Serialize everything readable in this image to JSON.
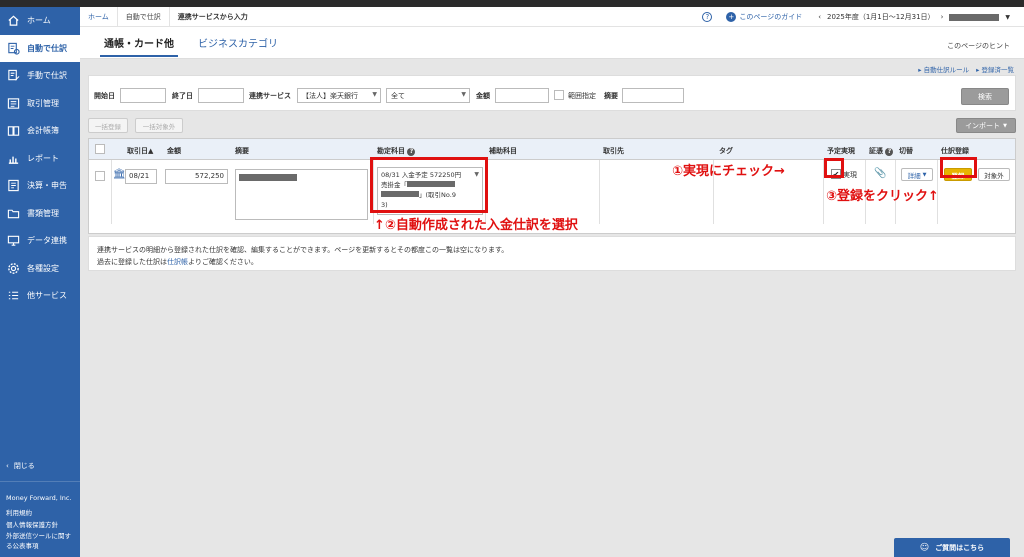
{
  "sidebar": {
    "items": [
      {
        "label": "ホーム",
        "icon": "home-icon"
      },
      {
        "label": "自動で仕訳",
        "icon": "auto-journal-icon"
      },
      {
        "label": "手動で仕訳",
        "icon": "manual-journal-icon"
      },
      {
        "label": "取引管理",
        "icon": "transaction-icon"
      },
      {
        "label": "会計帳簿",
        "icon": "ledger-icon"
      },
      {
        "label": "レポート",
        "icon": "report-icon"
      },
      {
        "label": "決算・申告",
        "icon": "settlement-icon"
      },
      {
        "label": "書類管理",
        "icon": "folder-icon"
      },
      {
        "label": "データ連携",
        "icon": "data-link-icon"
      },
      {
        "label": "各種設定",
        "icon": "gear-icon"
      },
      {
        "label": "他サービス",
        "icon": "list-icon"
      }
    ],
    "close_label": "閉じる",
    "company": "Money Forward, Inc.",
    "footer_links": [
      "利用規約",
      "個人情報保護方針",
      "外部送信ツールに関する公表事項"
    ]
  },
  "breadcrumb": {
    "home": "ホーム",
    "auto": "自動で仕訳",
    "current": "連携サービスから入力"
  },
  "header": {
    "guide": "このページのガイド",
    "fiscal": "2025年度（1月1日〜12月31日）"
  },
  "tabs": {
    "active": "通帳・カード他",
    "other": "ビジネスカテゴリ",
    "hint": "このページのヒント"
  },
  "sublinks": {
    "rule": "自動仕訳ルール",
    "registered": "登録済一覧"
  },
  "filter": {
    "start_label": "開始日",
    "end_label": "終了日",
    "service_label": "連携サービス",
    "service_value": "【法人】楽天銀行",
    "all_value": "全て",
    "amount_label": "金額",
    "range_label": "範囲指定",
    "desc_label": "摘要",
    "search": "検索"
  },
  "actions": {
    "bulk_register": "一括登録",
    "bulk_exclude": "一括対象外",
    "import": "インポート"
  },
  "table": {
    "headers": {
      "date": "取引日",
      "amount": "金額",
      "desc": "摘要",
      "account": "勘定科目",
      "sub": "補助科目",
      "partner": "取引先",
      "tag": "タグ",
      "planned": "予定実現",
      "evidence": "証憑",
      "switch": "切替",
      "register": "仕訳登録"
    },
    "row": {
      "date": "08/21",
      "amount": "572,250",
      "account_line1": "08/31 入金予定 572250円",
      "account_line2": "売掛金「",
      "account_line3": "」(取引No.9",
      "account_line4": "3)",
      "realized": "実現",
      "detail": "詳細",
      "register": "登録",
      "exclude": "対象外"
    }
  },
  "annotations": {
    "step1": "①実現にチェック→",
    "step2": "↑②自動作成された入金仕訳を選択",
    "step3": "③登録をクリック↑"
  },
  "notice": {
    "line1": "連携サービスの明細から登録された仕訳を確認、編集することができます。ページを更新するとその都度この一覧は空になります。",
    "line2_prefix": "過去に登録した仕訳は",
    "line2_link": "仕訳帳",
    "line2_suffix": "よりご確認ください。"
  },
  "help": {
    "label": "ご質問はこちら"
  },
  "colors": {
    "brand": "#2e62a8",
    "highlight": "#e01010",
    "register_btn": "#e8b400"
  }
}
